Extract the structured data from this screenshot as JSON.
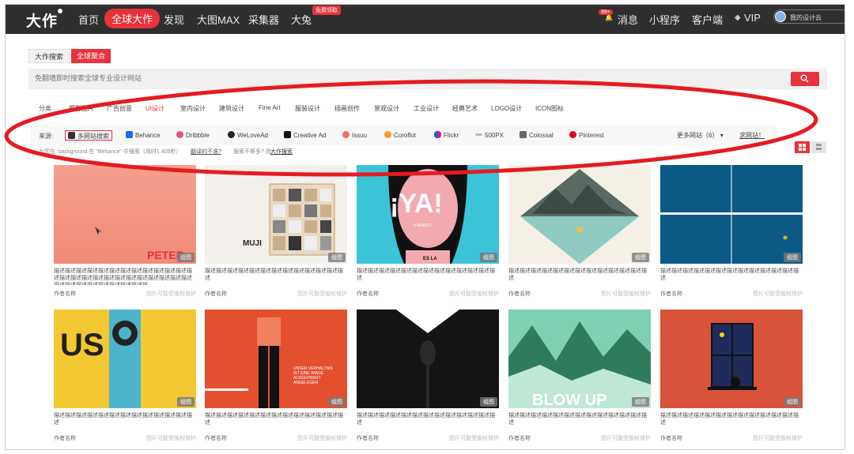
{
  "nav": {
    "logo": "大作",
    "items": [
      "首页",
      "全球大作",
      "发现",
      "大图MAX",
      "采集器",
      "大兔"
    ],
    "new_badge": "免费领取",
    "msg_badge": "99+",
    "right": [
      "消息",
      "小程序",
      "客户端",
      "VIP"
    ],
    "user": "我的设计云"
  },
  "search": {
    "tab1": "大作搜索",
    "tab2": "全球聚合",
    "placeholder": "免翻墙即时搜索全球专业设计网站"
  },
  "category": {
    "label": "分类",
    "items": [
      "摄影图片",
      "广告创意",
      "UI设计",
      "室内设计",
      "建筑设计",
      "Fine Art",
      "服装设计",
      "插画创作",
      "景观设计",
      "工业设计",
      "经典艺术",
      "LOGO设计",
      "ICON图标"
    ]
  },
  "source": {
    "label": "来源:",
    "items": [
      "多网站搜索",
      "Behance",
      "Dribbble",
      "WeLoveAd",
      "Creative Ad",
      "Issuu",
      "Coroflot",
      "Flickr",
      "500PX",
      "Colossal",
      "Pinterest"
    ],
    "more": "更多网站（6）",
    "request": "求网站！"
  },
  "hint": {
    "prefix": "为您在: background 在 \"Behance\" 中搜索（用时1.405秒）",
    "dissatisfied": "翻译的不准?",
    "notfound": "搜索不够多? 用",
    "link": "大作搜索"
  },
  "cards": [
    {
      "tag": "组图",
      "desc": "描述描述描述描述描述描述描述描述描述描述描述描述描述描述描述描述描述描述描述描述描述描述描述描述描述描述描述描述描述描述描述描述描述描...",
      "author": "作者名称",
      "note": "图片可能受版权保护"
    },
    {
      "tag": "组图",
      "desc": "描述描述描述描述描述描述描述描述描述描述描述描述描述",
      "author": "作者名称",
      "note": "图片可能受版权保护"
    },
    {
      "tag": "组图",
      "desc": "描述描述描述描述描述描述描述描述描述描述描述描述描述",
      "author": "作者名称",
      "note": "图片可能受版权保护"
    },
    {
      "tag": "组图",
      "desc": "描述描述描述描述描述描述描述描述描述描述描述描述描述",
      "author": "作者名称",
      "note": "图片可能受版权保护"
    },
    {
      "tag": "组图",
      "desc": "描述描述描述描述描述描述描述描述描述描述描述描述描述",
      "author": "作者名称",
      "note": "图片可能受版权保护"
    },
    {
      "tag": "组图",
      "desc": "描述描述描述描述描述描述描述描述描述描述描述描述描述",
      "author": "作者名称",
      "note": "图片可能受版权保护"
    },
    {
      "tag": "组图",
      "desc": "描述描述描述描述描述描述描述描述描述描述描述描述描述",
      "author": "作者名称",
      "note": "图片可能受版权保护"
    },
    {
      "tag": "组图",
      "desc": "描述描述描述描述描述描述描述描述描述描述描述描述描述",
      "author": "作者名称",
      "note": "图片可能受版权保护"
    },
    {
      "tag": "组图",
      "desc": "描述描述描述描述描述描述描述描述描述描述描述描述描述",
      "author": "作者名称",
      "note": "图片可能受版权保护"
    },
    {
      "tag": "组图",
      "desc": "描述描述描述描述描述描述描述描述描述描述描述描述描述",
      "author": "作者名称",
      "note": "图片可能受版权保护"
    }
  ],
  "artwork_text": {
    "a1": "PETER",
    "a2": "MUJI",
    "a3": "¡YA!",
    "a3b": "8 MARZO",
    "a3c": "ES LA",
    "a6": "US",
    "a8": "UNSER VERHALTNIS IST EINE IMAGE AUSGEPRAGT ANGELEGEN",
    "a10": "BLOW UP"
  },
  "colors": {
    "accent": "#e8323c",
    "nav_bg": "#2f2f2f"
  }
}
